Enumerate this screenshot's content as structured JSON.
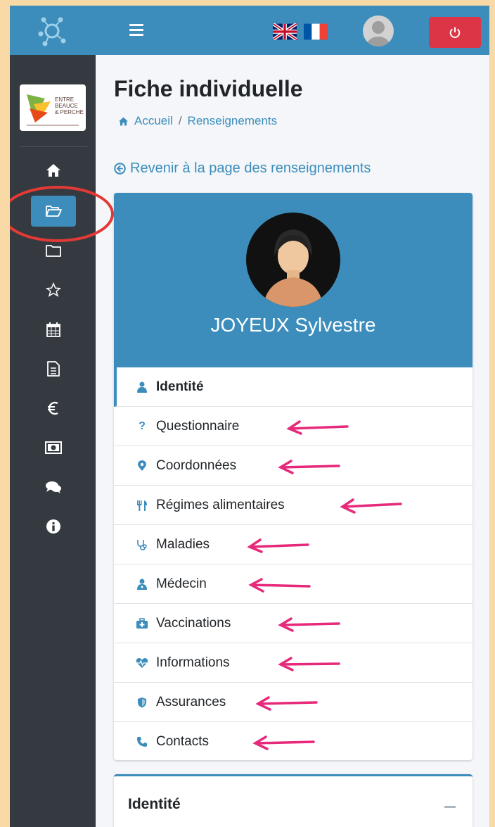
{
  "header": {
    "languages": [
      "en",
      "fr"
    ]
  },
  "sidebar": {
    "brand_lines": [
      "ENTRE",
      "BEAUCE",
      "& PERCHE"
    ],
    "items": [
      {
        "icon": "home-icon"
      },
      {
        "icon": "folder-open-icon",
        "active": true
      },
      {
        "icon": "folder-icon"
      },
      {
        "icon": "star-icon"
      },
      {
        "icon": "calendar-icon"
      },
      {
        "icon": "file-text-icon"
      },
      {
        "icon": "euro-icon"
      },
      {
        "icon": "money-bill-icon"
      },
      {
        "icon": "comments-icon"
      },
      {
        "icon": "info-circle-icon"
      }
    ]
  },
  "page": {
    "title": "Fiche individuelle",
    "breadcrumb": {
      "home": "Accueil",
      "separator": "/",
      "current": "Renseignements"
    },
    "back_link": "Revenir à la page des renseignements"
  },
  "profile": {
    "name": "JOYEUX Sylvestre",
    "menu": [
      {
        "label": "Identité",
        "icon": "user-icon",
        "active": true
      },
      {
        "label": "Questionnaire",
        "icon": "question-icon"
      },
      {
        "label": "Coordonnées",
        "icon": "map-marker-icon"
      },
      {
        "label": "Régimes alimentaires",
        "icon": "utensils-icon"
      },
      {
        "label": "Maladies",
        "icon": "stethoscope-icon"
      },
      {
        "label": "Médecin",
        "icon": "user-md-icon"
      },
      {
        "label": "Vaccinations",
        "icon": "medkit-icon"
      },
      {
        "label": "Informations",
        "icon": "heartbeat-icon"
      },
      {
        "label": "Assurances",
        "icon": "shield-icon"
      },
      {
        "label": "Contacts",
        "icon": "phone-icon"
      }
    ]
  },
  "section": {
    "title": "Identité"
  },
  "colors": {
    "primary": "#3c8dbc",
    "sidebar": "#343a40",
    "danger": "#dc3545",
    "annotation": "#e6297a",
    "outer": "#f9d9a5"
  }
}
